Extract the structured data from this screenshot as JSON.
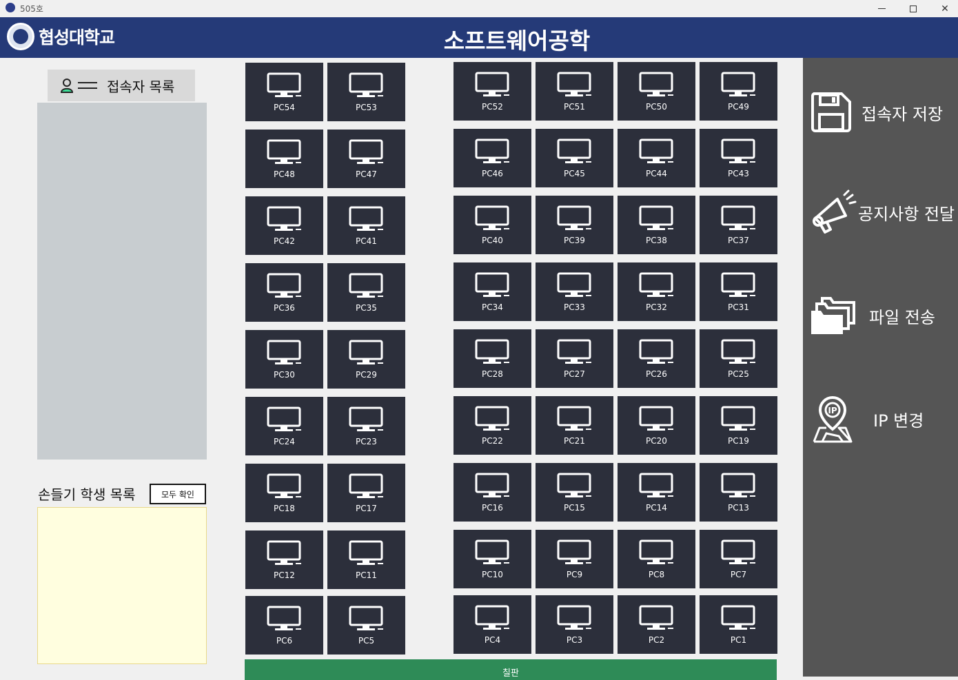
{
  "window": {
    "title": "505호"
  },
  "header": {
    "logo_text": "협성대학교",
    "page_title": "소프트웨어공학"
  },
  "left": {
    "users_title": "접속자 목록",
    "raise_title": "손들기 학생 목록",
    "confirm_all": "모두 확인"
  },
  "pcs": {
    "left_grid": [
      [
        "PC54",
        "PC53"
      ],
      [
        "PC48",
        "PC47"
      ],
      [
        "PC42",
        "PC41"
      ],
      [
        "PC36",
        "PC35"
      ],
      [
        "PC30",
        "PC29"
      ],
      [
        "PC24",
        "PC23"
      ],
      [
        "PC18",
        "PC17"
      ],
      [
        "PC12",
        "PC11"
      ],
      [
        "PC6",
        "PC5"
      ]
    ],
    "right_grid": [
      [
        "PC52",
        "PC51",
        "PC50",
        "PC49"
      ],
      [
        "PC46",
        "PC45",
        "PC44",
        "PC43"
      ],
      [
        "PC40",
        "PC39",
        "PC38",
        "PC37"
      ],
      [
        "PC34",
        "PC33",
        "PC32",
        "PC31"
      ],
      [
        "PC28",
        "PC27",
        "PC26",
        "PC25"
      ],
      [
        "PC22",
        "PC21",
        "PC20",
        "PC19"
      ],
      [
        "PC16",
        "PC15",
        "PC14",
        "PC13"
      ],
      [
        "PC10",
        "PC9",
        "PC8",
        "PC7"
      ],
      [
        "PC4",
        "PC3",
        "PC2",
        "PC1"
      ]
    ]
  },
  "board_label": "칠판",
  "sidebar": {
    "save_users": "접속자 저장",
    "send_notice": "공지사항 전달",
    "send_file": "파일 전송",
    "change_ip": "IP 변경"
  },
  "colors": {
    "header": "#253a78",
    "pc_tile": "#2c2f3b",
    "sidebar": "#555555",
    "board": "#2e8b57",
    "raise_list": "#fffedf"
  }
}
